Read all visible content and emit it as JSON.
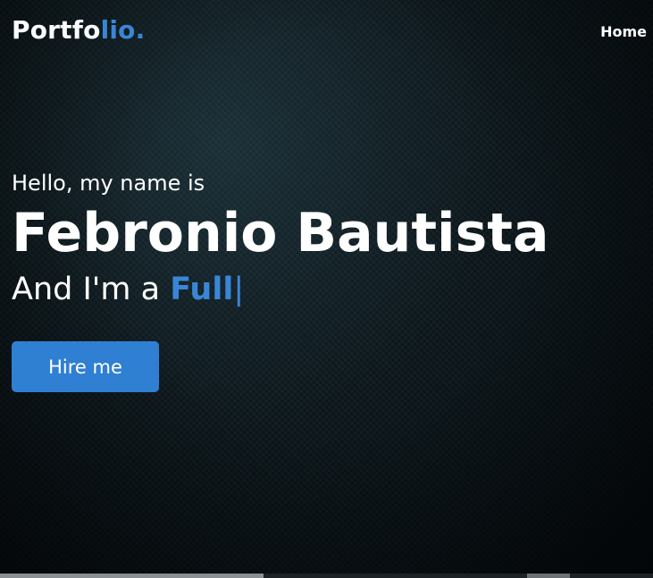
{
  "nav": {
    "logo_main": "Portfo",
    "logo_accent": "lio.",
    "home_label": "Home"
  },
  "hero": {
    "greeting": "Hello, my name is",
    "name": "Febronio Bautista",
    "role_prefix": "And I'm a",
    "role_typed": "Full",
    "cursor": "|",
    "hire_button": "Hire me"
  },
  "colors": {
    "accent": "#3a86d6",
    "button": "#2f7fd3",
    "background": "#0c171b",
    "text": "#ffffff"
  }
}
